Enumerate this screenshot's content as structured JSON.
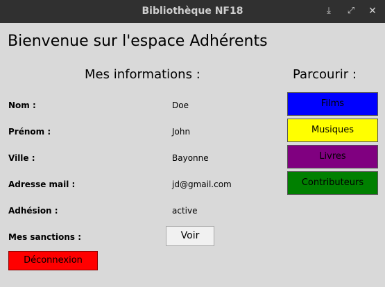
{
  "window": {
    "title": "Bibliothèque NF18",
    "controls": {
      "minimize": "⤓",
      "maximize": "⤢",
      "close": "✕"
    }
  },
  "heading": "Bienvenue sur l'espace Adhérents",
  "info": {
    "title": "Mes informations :",
    "rows": [
      {
        "label": "Nom :",
        "value": "Doe"
      },
      {
        "label": "Prénom :",
        "value": "John"
      },
      {
        "label": "Ville :",
        "value": "Bayonne"
      },
      {
        "label": "Adresse mail :",
        "value": "jd@gmail.com"
      },
      {
        "label": "Adhésion :",
        "value": "active"
      }
    ],
    "sanctions_label": "Mes sanctions :",
    "sanctions_button": "Voir"
  },
  "logout_button": "Déconnexion",
  "browse": {
    "title": "Parcourir :",
    "buttons": [
      {
        "label": "Films",
        "color": "#0000ff"
      },
      {
        "label": "Musiques",
        "color": "#ffff00"
      },
      {
        "label": "Livres",
        "color": "#800080"
      },
      {
        "label": "Contributeurs",
        "color": "#008000"
      }
    ]
  },
  "colors": {
    "background": "#d9d9d9",
    "titlebar": "#303030",
    "logout": "#ff0000"
  }
}
